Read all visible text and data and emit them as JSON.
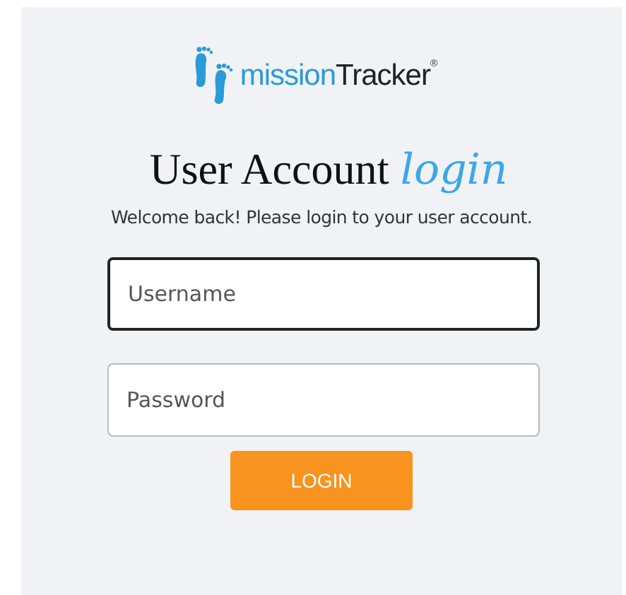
{
  "logo": {
    "word_1": "mission",
    "word_2": "Tracker",
    "mark": "®"
  },
  "heading": {
    "text": "User Account",
    "accent": "login"
  },
  "subtitle": "Welcome back! Please login to your user account.",
  "fields": [
    {
      "placeholder": "Username",
      "focused": true
    },
    {
      "placeholder": "Password",
      "focused": false
    }
  ],
  "button": "LOGIN"
}
